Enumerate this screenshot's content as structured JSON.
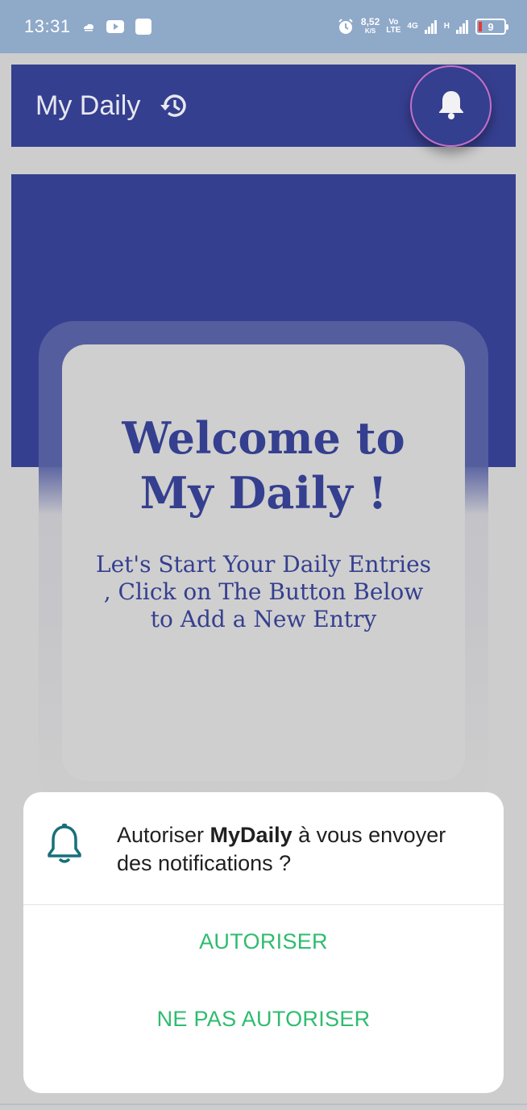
{
  "status_bar": {
    "time": "13:31",
    "net_speed_value": "8,52",
    "net_speed_unit": "K/S",
    "volte_top": "Vo",
    "volte_bottom": "LTE",
    "net_type": "4G",
    "sim2_type": "H",
    "battery_level": "9",
    "icons": [
      "weather-icon",
      "youtube-icon",
      "app-square-icon",
      "alarm-icon",
      "signal-icon",
      "signal-icon"
    ]
  },
  "app_bar": {
    "title": "My Daily",
    "history_icon": "history-icon",
    "notification_icon": "bell-icon"
  },
  "welcome": {
    "title": "Welcome to My Daily !",
    "subtitle": "Let's Start Your Daily Entries , Click on The Button Below to Add a New Entry"
  },
  "dialog": {
    "icon": "bell-outline-icon",
    "message_prefix": "Autoriser ",
    "app_name": "MyDaily",
    "message_suffix": " à vous envoyer des notifications ?",
    "allow_label": "AUTORISER",
    "deny_label": "NE PAS AUTORISER"
  },
  "colors": {
    "primary": "#353f8f",
    "status_bar": "#8fa9c9",
    "dialog_button": "#2ebc6f",
    "fab_ring": "#c56fc8"
  }
}
